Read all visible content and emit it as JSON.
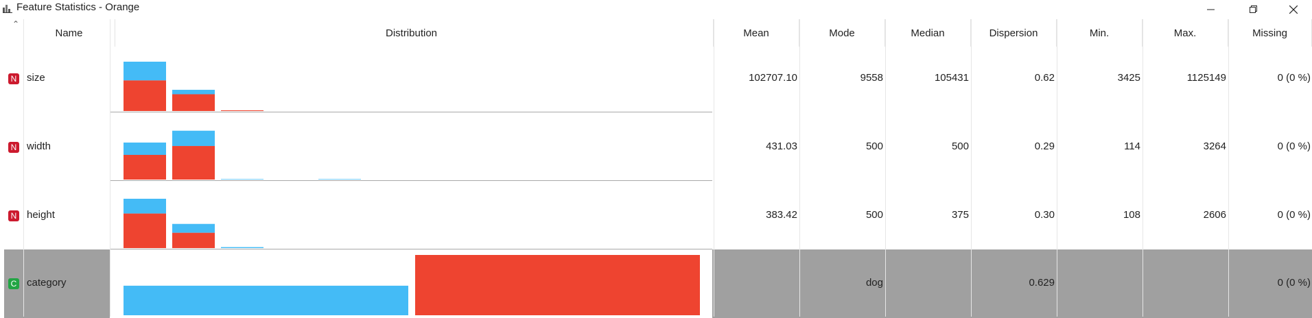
{
  "window": {
    "title": "Feature Statistics - Orange"
  },
  "columns": [
    "Name",
    "Distribution",
    "Mean",
    "Mode",
    "Median",
    "Dispersion",
    "Min.",
    "Max.",
    "Missing"
  ],
  "rows": [
    {
      "type_badge": "N",
      "name": "size",
      "mean": "102707.10",
      "mode": "9558",
      "median": "105431",
      "dispersion": "0.62",
      "min": "3425",
      "max": "1125149",
      "missing": "0 (0 %)",
      "selected": false,
      "distribution": [
        {
          "red": 0.62,
          "blue": 0.38
        },
        {
          "red": 0.34,
          "blue": 0.09
        },
        {
          "red": 0.015,
          "blue": 0.0
        }
      ]
    },
    {
      "type_badge": "N",
      "name": "width",
      "mean": "431.03",
      "mode": "500",
      "median": "500",
      "dispersion": "0.29",
      "min": "114",
      "max": "3264",
      "missing": "0 (0 %)",
      "selected": false,
      "distribution": [
        {
          "red": 0.5,
          "blue": 0.25
        },
        {
          "red": 0.68,
          "blue": 0.31
        },
        {
          "red": 0.0,
          "blue": 0.01
        },
        {
          "red": 0.0,
          "blue": 0.0
        },
        {
          "red": 0.0,
          "blue": 0.01
        }
      ]
    },
    {
      "type_badge": "N",
      "name": "height",
      "mean": "383.42",
      "mode": "500",
      "median": "375",
      "dispersion": "0.30",
      "min": "108",
      "max": "2606",
      "missing": "0 (0 %)",
      "selected": false,
      "distribution": [
        {
          "red": 0.7,
          "blue": 0.3
        },
        {
          "red": 0.31,
          "blue": 0.18
        },
        {
          "red": 0.0,
          "blue": 0.02
        }
      ]
    },
    {
      "type_badge": "C",
      "name": "category",
      "mean": "",
      "mode": "dog",
      "median": "",
      "dispersion": "0.629",
      "min": "",
      "max": "",
      "missing": "0 (0 %)",
      "selected": true,
      "distribution": [
        {
          "color": "#44bbf6",
          "value": 0.49
        },
        {
          "color": "#ee4430",
          "value": 1.0
        }
      ]
    }
  ],
  "colors": {
    "blue": "#44bbf6",
    "red": "#ee4430",
    "numeric_badge": "#cc1a2e",
    "categorical_badge": "#22a544",
    "selected_row": "#a0a0a0"
  }
}
